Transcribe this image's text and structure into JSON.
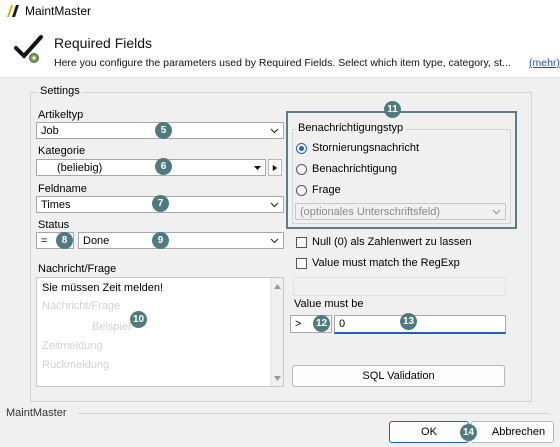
{
  "window": {
    "title": "MaintMaster"
  },
  "header": {
    "title": "Required Fields",
    "description": "Here you configure the parameters used by Required Fields. Select which item type, category, st...",
    "more_link": "(mehr)"
  },
  "settings": {
    "group_label": "Settings",
    "artikeltyp": {
      "label": "Artikeltyp",
      "value": "Job",
      "badge": "5"
    },
    "kategorie": {
      "label": "Kategorie",
      "value": "(beliebig)",
      "badge": "6"
    },
    "feldname": {
      "label": "Feldname",
      "value": "Times",
      "badge": "7"
    },
    "status": {
      "label": "Status",
      "operator": "=",
      "operator_badge": "8",
      "value": "Done",
      "value_badge": "9"
    },
    "nachricht": {
      "label": "Nachricht/Frage",
      "value": "Sie müssen Zeit melden!",
      "badge": "10",
      "ghost_lines": [
        "Nachricht/Frage",
        "Beispiel",
        "Zeitmeldung",
        "Rückmeldung"
      ]
    }
  },
  "notification": {
    "badge": "11",
    "group_label": "Benachrichtigungstyp",
    "options": [
      {
        "label": "Stornierungsnachricht",
        "selected": true
      },
      {
        "label": "Benachrichtigung",
        "selected": false
      },
      {
        "label": "Frage",
        "selected": false
      }
    ],
    "signature_placeholder": "(optionales Unterschriftsfeld)"
  },
  "checks": {
    "null_zero": {
      "label": "Null (0) als Zahlenwert zu lassen",
      "checked": false
    },
    "regexp": {
      "label": "Value must match the RegExp",
      "checked": false
    }
  },
  "value_must_be": {
    "label": "Value must be",
    "operator": ">",
    "operator_badge": "12",
    "value": "0",
    "value_badge": "13"
  },
  "sql_button": "SQL Validation",
  "footer": {
    "group_label": "MaintMaster",
    "ok": "OK",
    "cancel": "Abbrechen",
    "badge": "14"
  },
  "colors": {
    "badge": "#4f7a80",
    "accent": "#1f5fbf",
    "link": "#1f4fbf",
    "highlight_border": "#5b7c82"
  },
  "icons": {
    "app": "maintmaster-logo-icon",
    "header": "checkmark-gear-icon"
  }
}
